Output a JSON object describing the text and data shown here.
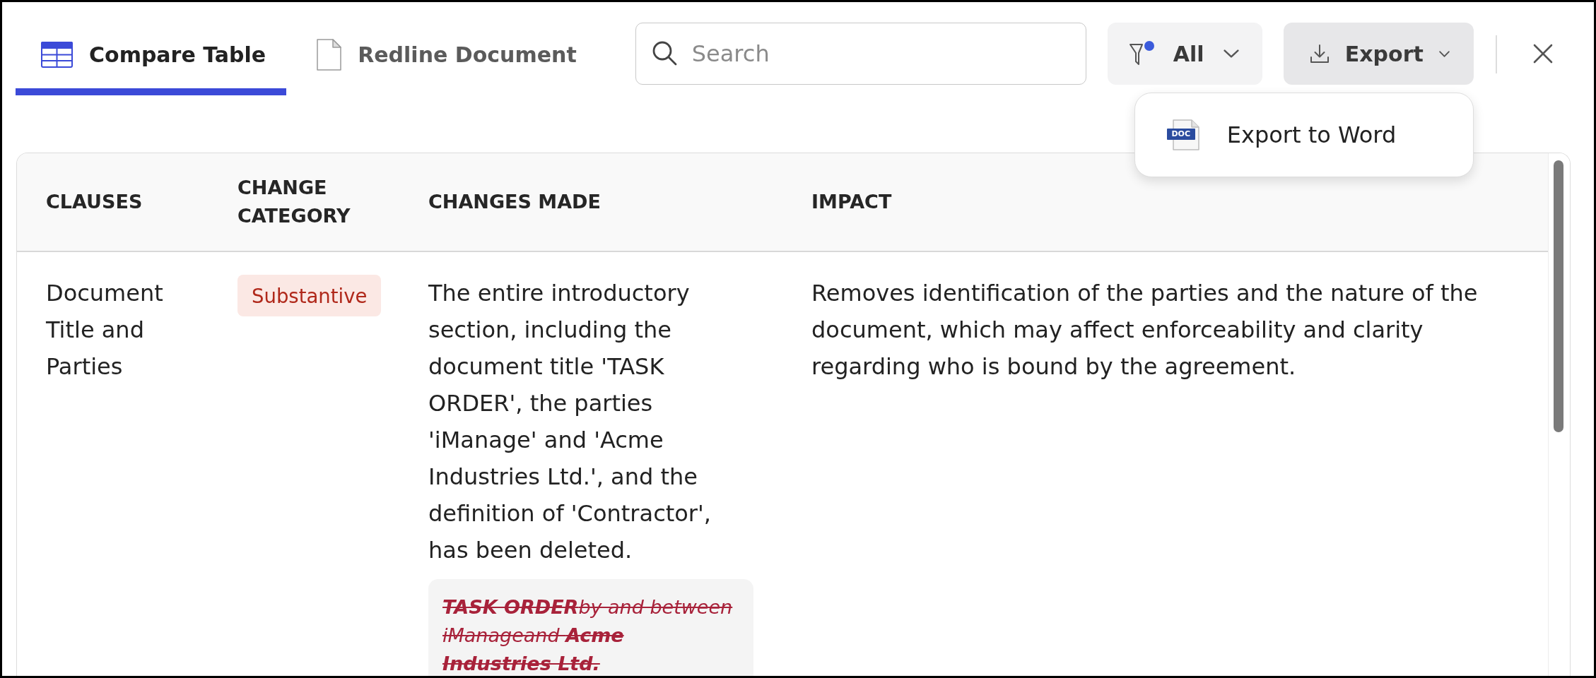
{
  "tabs": [
    {
      "label": "Compare Table",
      "kind": "table",
      "selected": true
    },
    {
      "label": "Redline Document",
      "kind": "document",
      "selected": false
    }
  ],
  "search": {
    "placeholder": "Search"
  },
  "filter": {
    "label": "All",
    "active": true,
    "expanded": false
  },
  "export": {
    "label": "Export",
    "expanded": true,
    "menu": [
      {
        "label": "Export to Word",
        "kind": "word",
        "icon_label": "DOC"
      }
    ]
  },
  "table": {
    "columns": [
      "CLAUSES",
      "CHANGE CATEGORY",
      "CHANGES MADE",
      "IMPACT"
    ],
    "rows": [
      {
        "clause": "Document Title and Parties",
        "category": "Substantive",
        "change": "The entire introductory section, including the document title 'TASK ORDER', the parties 'iManage' and 'Acme Industries Ltd.', and the definition of 'Contractor', has been deleted.",
        "deleted_text": "**TASK ORDER**by and between iManageand **Acme Industries Ltd.**",
        "impact": "Removes identification of the parties and the nature of the document, which may affect enforceability and clarity regarding who is bound by the agreement."
      }
    ]
  }
}
